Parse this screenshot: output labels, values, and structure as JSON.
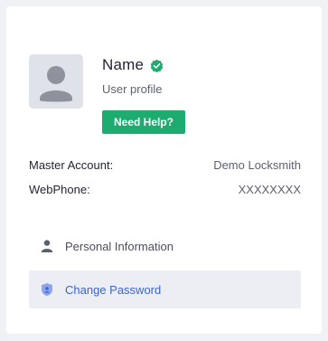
{
  "profile": {
    "name": "Name",
    "subtitle": "User profile",
    "help_label": "Need Help?",
    "verified_icon": "verified-badge-icon",
    "avatar_icon": "user-avatar-icon"
  },
  "info": [
    {
      "label": "Master Account:",
      "value": "Demo Locksmith"
    },
    {
      "label": "WebPhone:",
      "value": "XXXXXXXX"
    }
  ],
  "menu": [
    {
      "label": "Personal Information",
      "icon": "person-icon",
      "active": false
    },
    {
      "label": "Change Password",
      "icon": "shield-icon",
      "active": true
    }
  ],
  "colors": {
    "accent_green": "#1dab6f",
    "link_blue": "#3b62d6",
    "active_bg": "#eceef3"
  }
}
